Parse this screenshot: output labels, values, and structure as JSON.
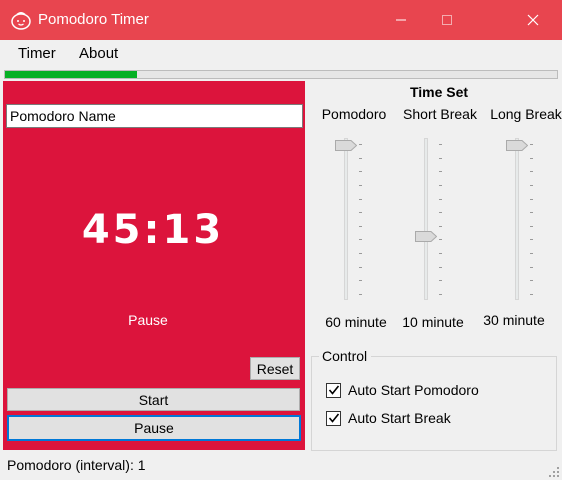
{
  "window": {
    "title": "Pomodoro Timer",
    "controls": {
      "minimize": "—",
      "maximize": "☐",
      "close": "✕"
    }
  },
  "menu": {
    "items": [
      {
        "label": "Timer"
      },
      {
        "label": "About"
      }
    ]
  },
  "progress": {
    "fraction": 0.24,
    "color": "#06b025"
  },
  "timer_panel": {
    "background": "#dc143c",
    "name_value": "Pomodoro Name",
    "time_display": "45:13",
    "status_text": "Pause",
    "reset_label": "Reset",
    "start_label": "Start",
    "pause_label": "Pause"
  },
  "time_set": {
    "title": "Time Set",
    "sliders": [
      {
        "label": "Pomodoro",
        "value_text": "60 minute",
        "level_fraction": 1.0
      },
      {
        "label": "Short Break",
        "value_text": "10 minute",
        "level_fraction": 0.38
      },
      {
        "label": "Long Break",
        "value_text": "30 minute",
        "level_fraction": 1.0
      }
    ]
  },
  "control": {
    "legend": "Control",
    "options": [
      {
        "label": "Auto Start Pomodoro",
        "checked": true
      },
      {
        "label": "Auto Start Break",
        "checked": true
      }
    ]
  },
  "statusbar": {
    "text": "Pomodoro (interval): 1"
  },
  "colors": {
    "titlebar": "#e8454f",
    "focus_border": "#0078d7"
  }
}
